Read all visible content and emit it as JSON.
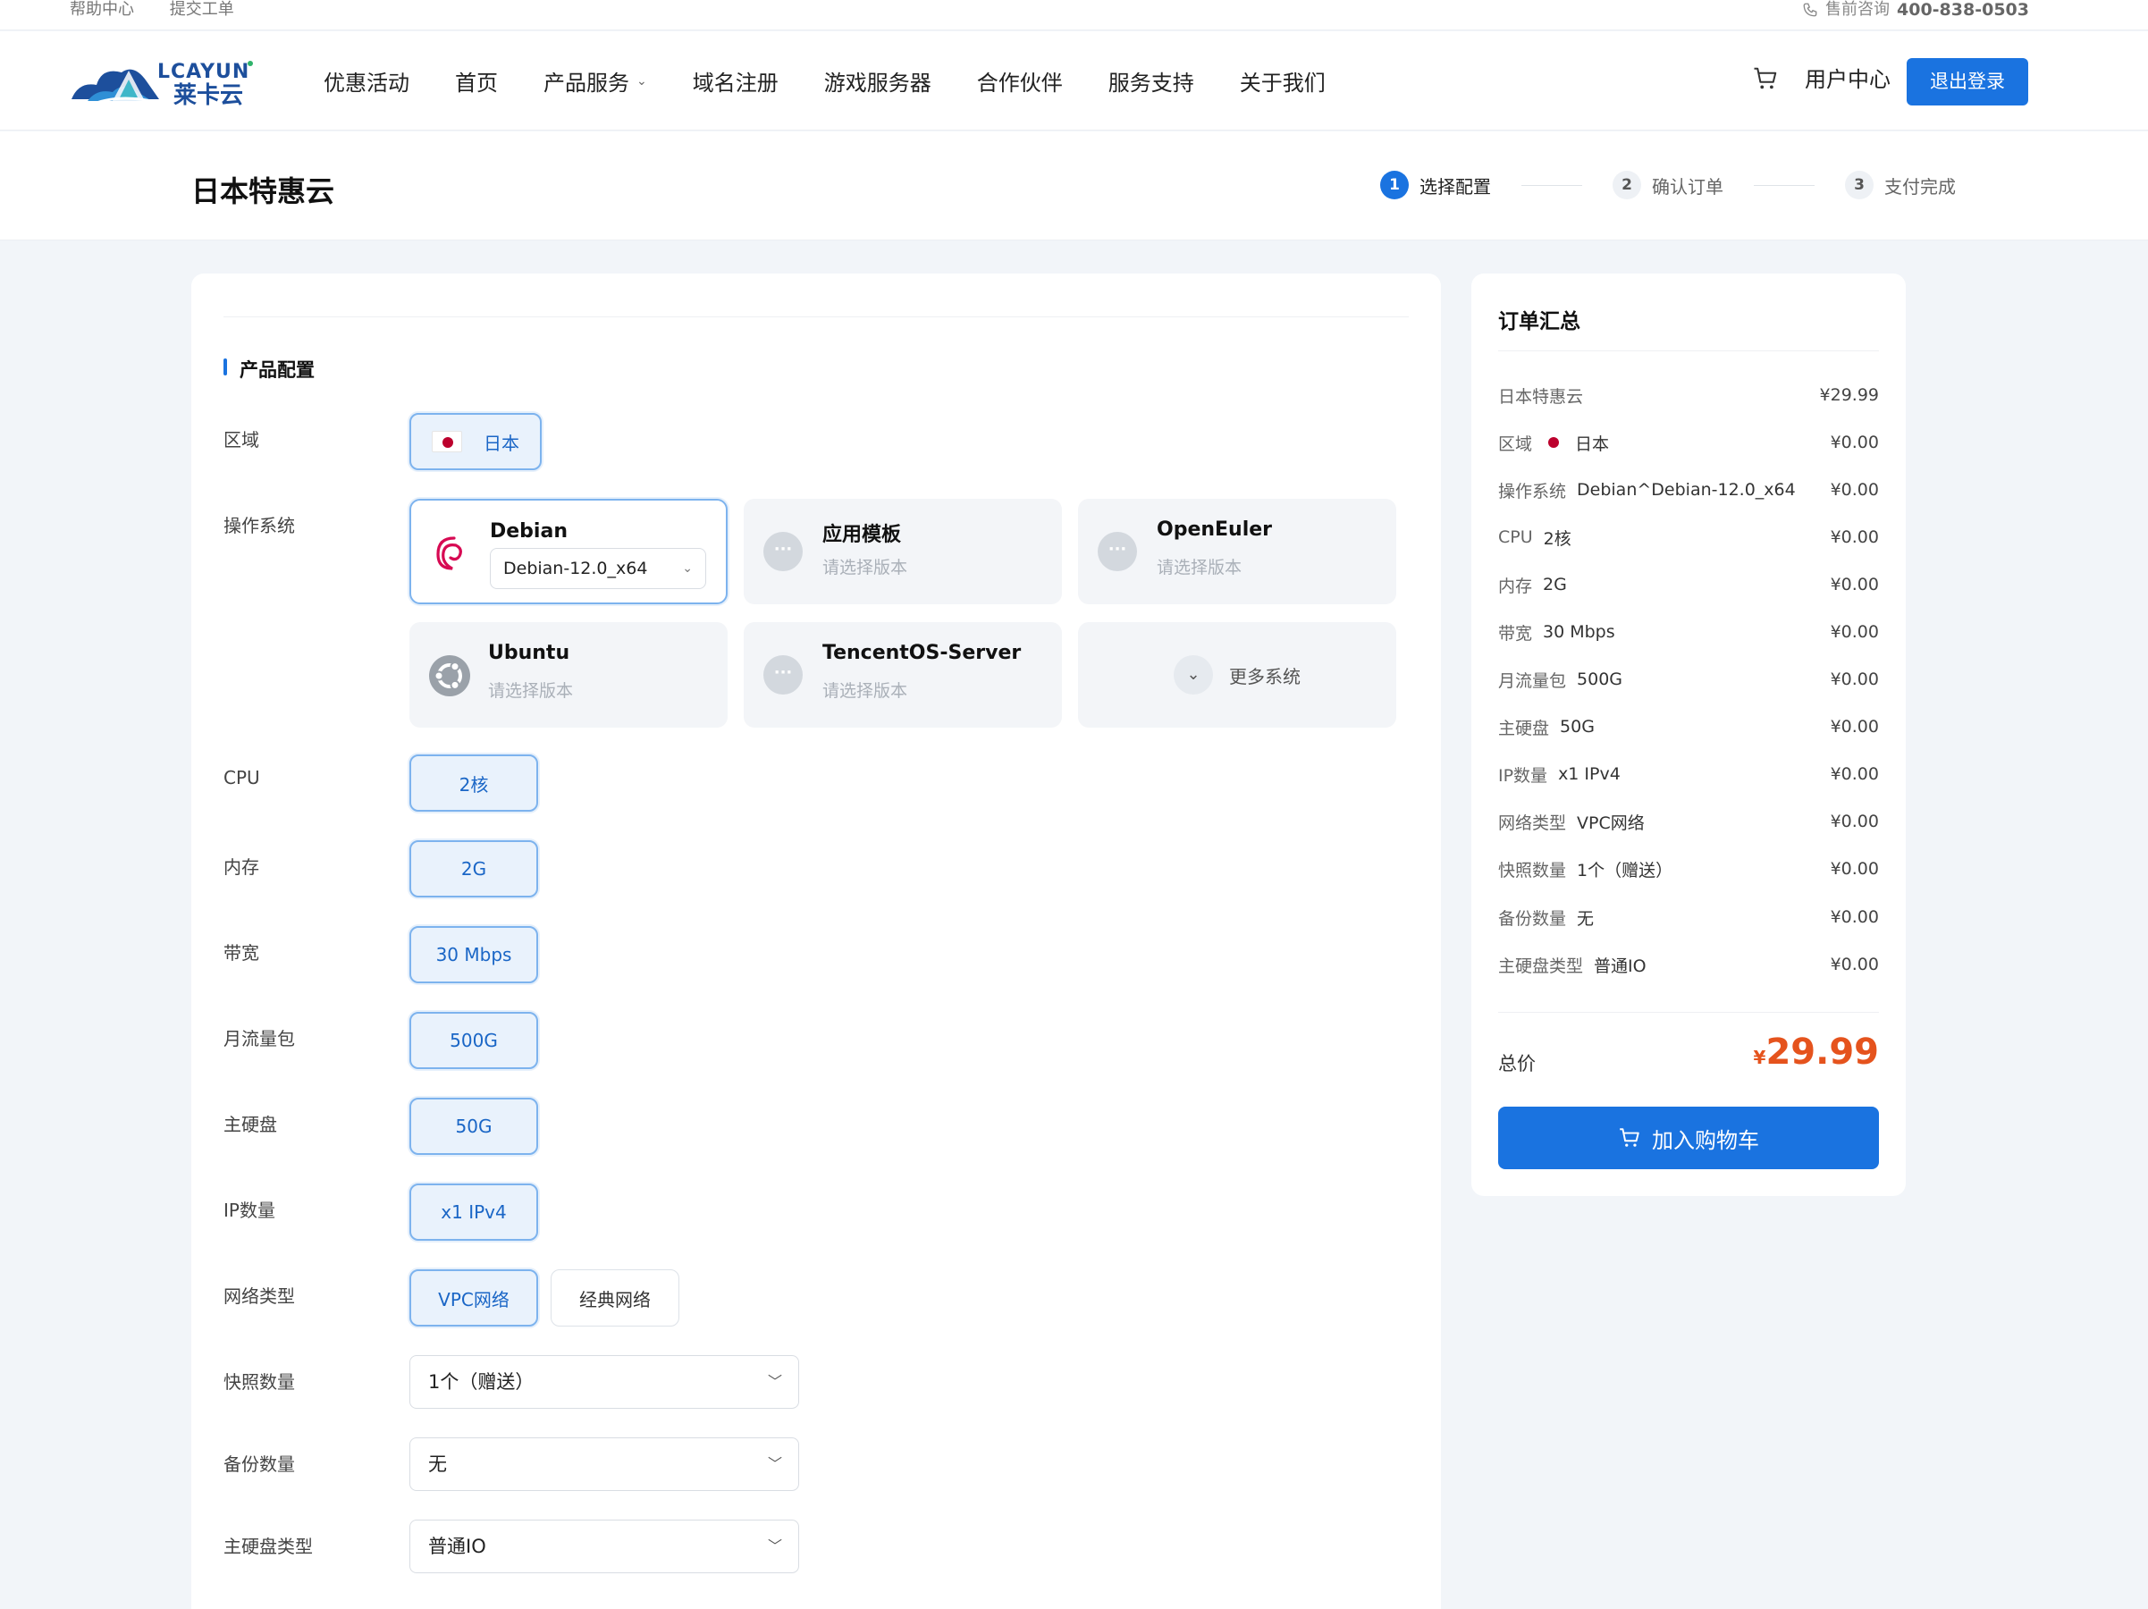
{
  "topbar": {
    "help": "帮助中心",
    "ticket": "提交工单",
    "presale_label": "售前咨询",
    "presale_phone": "400-838-0503"
  },
  "brand": {
    "logo_text": "LCAYUN",
    "logo_cn": "莱卡云",
    "accent": "#1a73e0"
  },
  "nav": {
    "items": [
      "优惠活动",
      "首页",
      "产品服务",
      "域名注册",
      "游戏服务器",
      "合作伙伴",
      "服务支持",
      "关于我们"
    ],
    "user_center": "用户中心",
    "logout": "退出登录"
  },
  "page": {
    "title": "日本特惠云",
    "steps": [
      {
        "num": "1",
        "label": "选择配置",
        "active": true
      },
      {
        "num": "2",
        "label": "确认订单",
        "active": false
      },
      {
        "num": "3",
        "label": "支付完成",
        "active": false
      }
    ]
  },
  "config": {
    "section_title": "产品配置",
    "labels": {
      "region": "区域",
      "os": "操作系统",
      "cpu": "CPU",
      "memory": "内存",
      "bandwidth": "带宽",
      "traffic": "月流量包",
      "disk": "主硬盘",
      "ip": "IP数量",
      "network": "网络类型",
      "snapshot": "快照数量",
      "backup": "备份数量",
      "disk_type": "主硬盘类型"
    },
    "region": "日本",
    "os": [
      {
        "name": "Debian",
        "version": "Debian-12.0_x64",
        "selected": true
      },
      {
        "name": "应用模板",
        "placeholder": "请选择版本"
      },
      {
        "name": "OpenEuler",
        "placeholder": "请选择版本"
      },
      {
        "name": "Ubuntu",
        "placeholder": "请选择版本"
      },
      {
        "name": "TencentOS-Server",
        "placeholder": "请选择版本"
      }
    ],
    "more_os": "更多系统",
    "cpu": "2核",
    "memory": "2G",
    "bandwidth": "30 Mbps",
    "traffic": "500G",
    "disk": "50G",
    "ip": "x1 IPv4",
    "network": [
      "VPC网络",
      "经典网络"
    ],
    "snapshot": "1个（赠送）",
    "backup": "无",
    "disk_type": "普通IO"
  },
  "summary": {
    "title": "订单汇总",
    "rows": [
      {
        "k": "日本特惠云",
        "v": "",
        "price": "¥29.99"
      },
      {
        "k": "区域",
        "v": "日本",
        "price": "¥0.00",
        "flag": true
      },
      {
        "k": "操作系统",
        "v": "Debian^Debian-12.0_x64",
        "price": "¥0.00"
      },
      {
        "k": "CPU",
        "v": "2核",
        "price": "¥0.00"
      },
      {
        "k": "内存",
        "v": "2G",
        "price": "¥0.00"
      },
      {
        "k": "带宽",
        "v": "30 Mbps",
        "price": "¥0.00"
      },
      {
        "k": "月流量包",
        "v": "500G",
        "price": "¥0.00"
      },
      {
        "k": "主硬盘",
        "v": "50G",
        "price": "¥0.00"
      },
      {
        "k": "IP数量",
        "v": "x1 IPv4",
        "price": "¥0.00"
      },
      {
        "k": "网络类型",
        "v": "VPC网络",
        "price": "¥0.00"
      },
      {
        "k": "快照数量",
        "v": "1个（赠送）",
        "price": "¥0.00"
      },
      {
        "k": "备份数量",
        "v": "无",
        "price": "¥0.00"
      },
      {
        "k": "主硬盘类型",
        "v": "普通IO",
        "price": "¥0.00"
      }
    ],
    "total_label": "总价",
    "currency": "¥",
    "total": "29.99",
    "add_cart": "加入购物车"
  }
}
